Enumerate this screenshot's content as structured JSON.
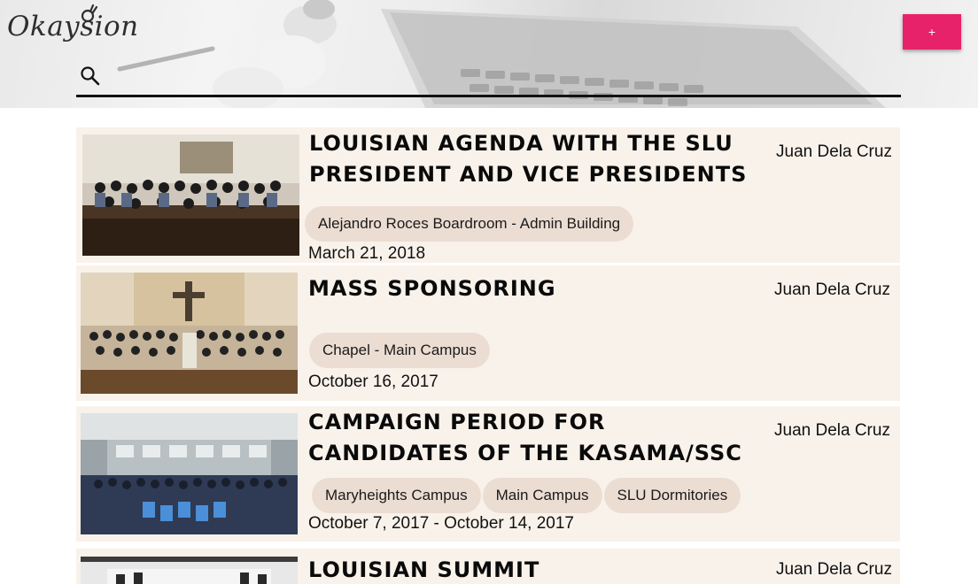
{
  "brand": {
    "name": "Okaysion",
    "logo_icon": "ok-hand-icon"
  },
  "header": {
    "add_label": "+"
  },
  "search": {
    "placeholder": "",
    "value": ""
  },
  "events": [
    {
      "title_lines": [
        "Louisian Agenda with the SLU",
        "President and Vice Presidents"
      ],
      "author": "Juan Dela Cruz",
      "venues": [
        "Alejandro Roces Boardroom - Admin Building"
      ],
      "date": "March 21, 2018"
    },
    {
      "title_lines": [
        "Mass Sponsoring"
      ],
      "author": "Juan Dela Cruz",
      "venues": [
        "Chapel - Main Campus"
      ],
      "date": "October 16, 2017"
    },
    {
      "title_lines": [
        "Campaign Period for",
        "Candidates of the KASAMA/SSC"
      ],
      "author": "Juan Dela Cruz",
      "venues": [
        "Maryheights Campus",
        "Main Campus",
        "SLU Dormitories"
      ],
      "date": "October 7, 2017 - October 14, 2017"
    },
    {
      "title_lines": [
        "Louisian Summit"
      ],
      "author": "Juan Dela Cruz",
      "venues": [],
      "date": ""
    }
  ],
  "colors": {
    "accent": "#e8226a",
    "card_bg": "#f8f2eb",
    "tag_bg": "#ecddd3"
  }
}
